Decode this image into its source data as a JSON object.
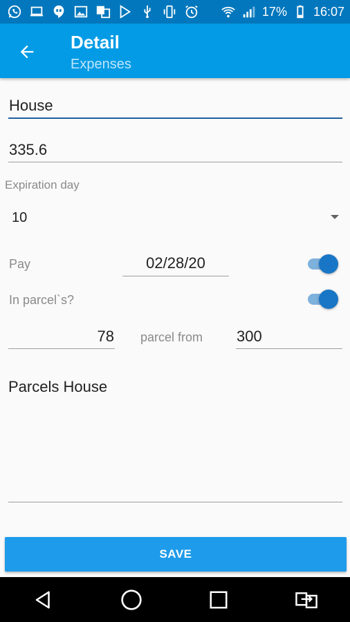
{
  "status_bar": {
    "battery_percent": "17%",
    "time": "16:07",
    "left_icons": [
      "whatsapp-icon",
      "laptop-icon",
      "hangouts-icon",
      "image-icon",
      "translate-icon",
      "play-store-icon",
      "usb-icon",
      "vibrate-icon",
      "alarm-icon"
    ],
    "right_icons": [
      "wifi-icon",
      "signal-icon",
      "battery-icon"
    ]
  },
  "app_bar": {
    "title": "Detail",
    "subtitle": "Expenses"
  },
  "form": {
    "name_value": "House",
    "amount_value": "335.6",
    "expiration_label": "Expiration day",
    "expiration_value": "10",
    "pay_label": "Pay",
    "pay_date": "02/28/20",
    "pay_toggle_on": true,
    "in_parcels_label": "In parcel`s?",
    "in_parcels_toggle_on": true,
    "parcel_current": "78",
    "parcel_from_label": "parcel from",
    "parcel_total": "300",
    "notes_value": "Parcels House"
  },
  "actions": {
    "save_label": "SAVE"
  },
  "colors": {
    "status_bar": "#0277bd",
    "app_bar": "#039be5",
    "accent": "#1976c6",
    "save_button": "#1e9bea"
  }
}
